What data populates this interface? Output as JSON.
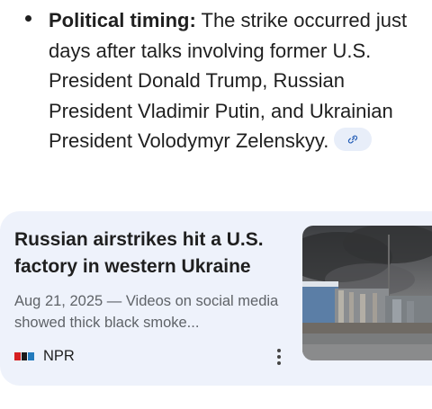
{
  "bullet": {
    "label": "Political timing:",
    "text": " The strike occurred just days after talks involving former U.S. President Donald Trump, Russian President Vladimir Putin, and Ukrainian President Volodymyr Zelenskyy.",
    "link_icon": "link-icon"
  },
  "card": {
    "title": "Russian airstrikes hit a U.S. factory in western Ukraine",
    "snippet": "Aug 21, 2025 — Videos on social media showed thick black smoke...",
    "source": "NPR",
    "source_logo": "npr-logo",
    "menu_icon": "more-vert-icon"
  },
  "colors": {
    "card_background": "#eef2fb",
    "chip_background": "#e8eef9",
    "npr_red": "#d62021",
    "npr_black": "#1a1a1a",
    "npr_blue": "#237bbd"
  }
}
